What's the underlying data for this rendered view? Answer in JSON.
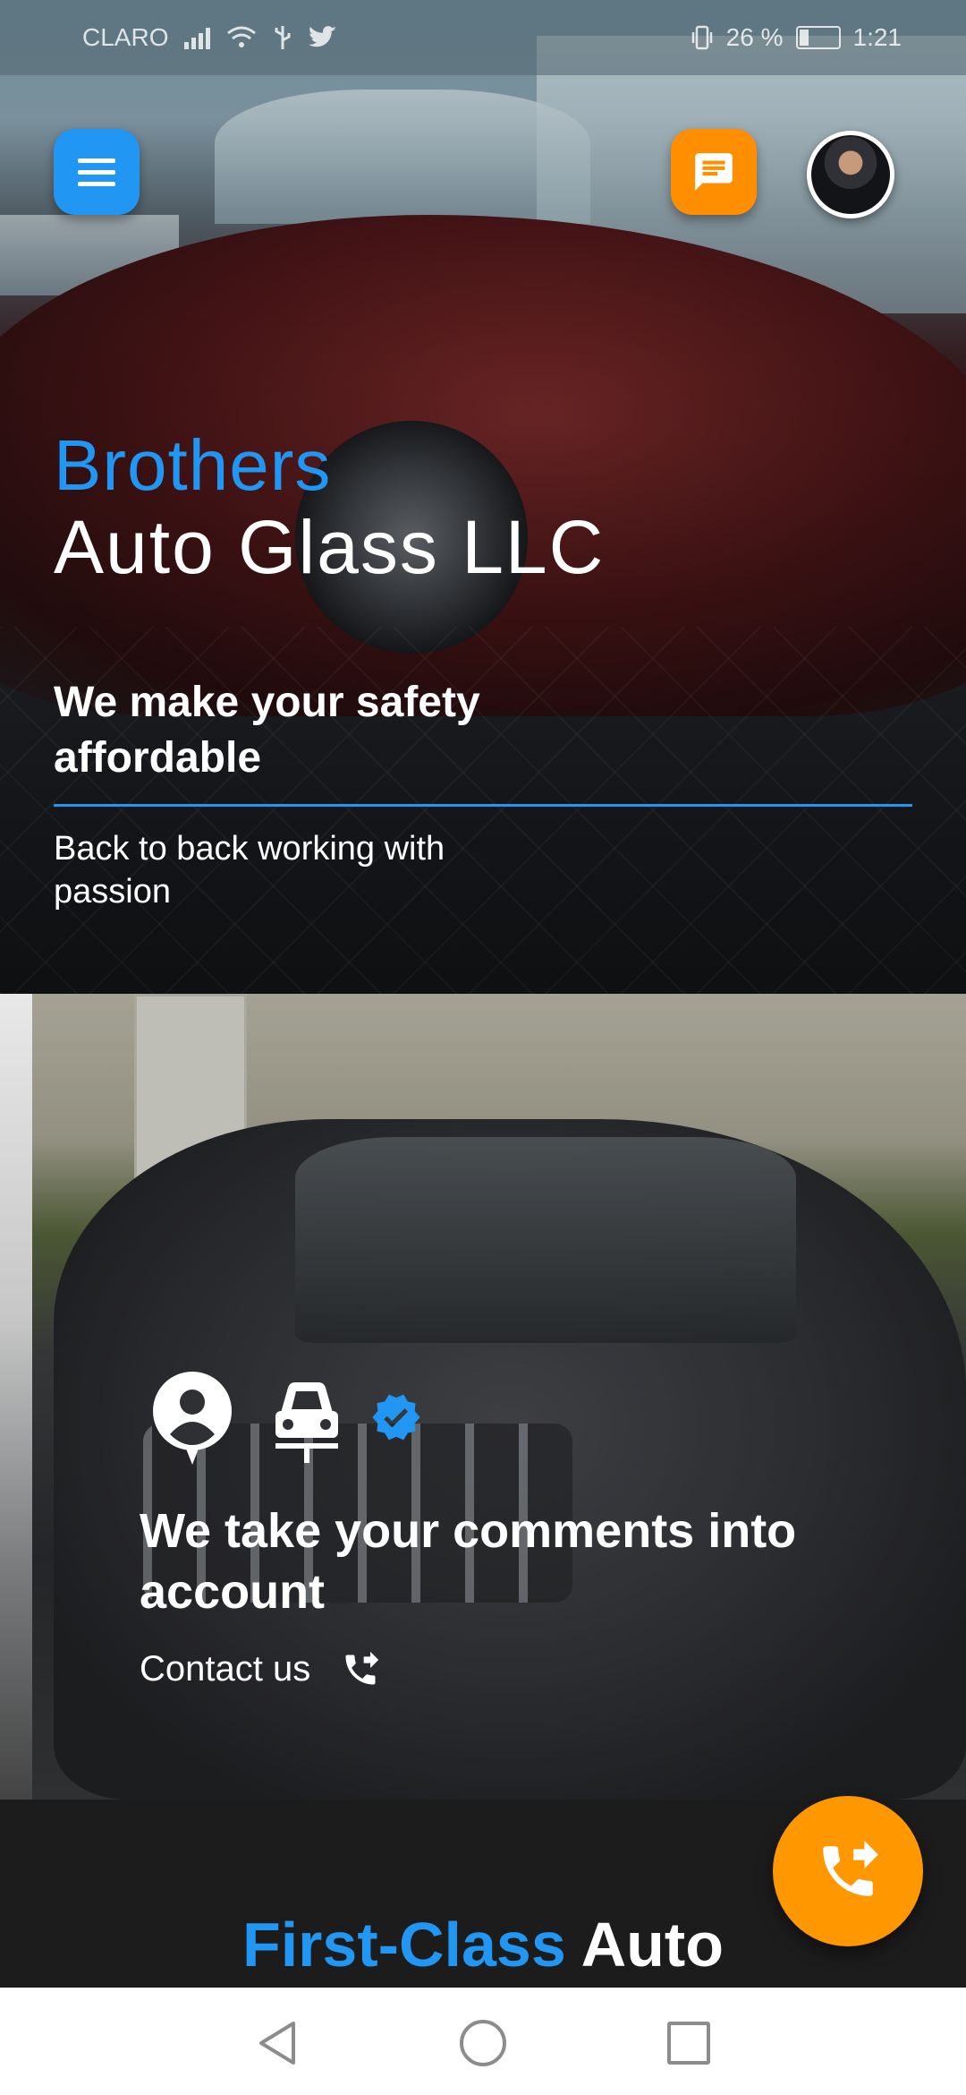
{
  "status_bar": {
    "carrier": "CLARO",
    "battery": "26 %",
    "time": "1:21"
  },
  "header": {
    "menu_icon": "hamburger-menu-icon",
    "chat_icon": "chat-bubble-icon",
    "avatar_icon": "profile-avatar"
  },
  "hero": {
    "brand_line1": "Brothers",
    "brand_line2": "Auto Glass LLC",
    "tagline": "We make your safety affordable",
    "subtagline": "Back to back working with passion"
  },
  "feedback": {
    "title": "We take your comments into account",
    "contact_label": "Contact us",
    "icons": [
      "person-pin-icon",
      "car-wash-icon",
      "verified-badge-icon",
      "phone-forwarded-icon"
    ]
  },
  "services": {
    "title_blue": "First-Class",
    "title_white": "Auto"
  },
  "fab": {
    "icon": "phone-forwarded-icon"
  },
  "colors": {
    "primary_blue": "#2196f3",
    "accent_orange": "#ff8f00",
    "fab_orange": "#ff9800"
  }
}
